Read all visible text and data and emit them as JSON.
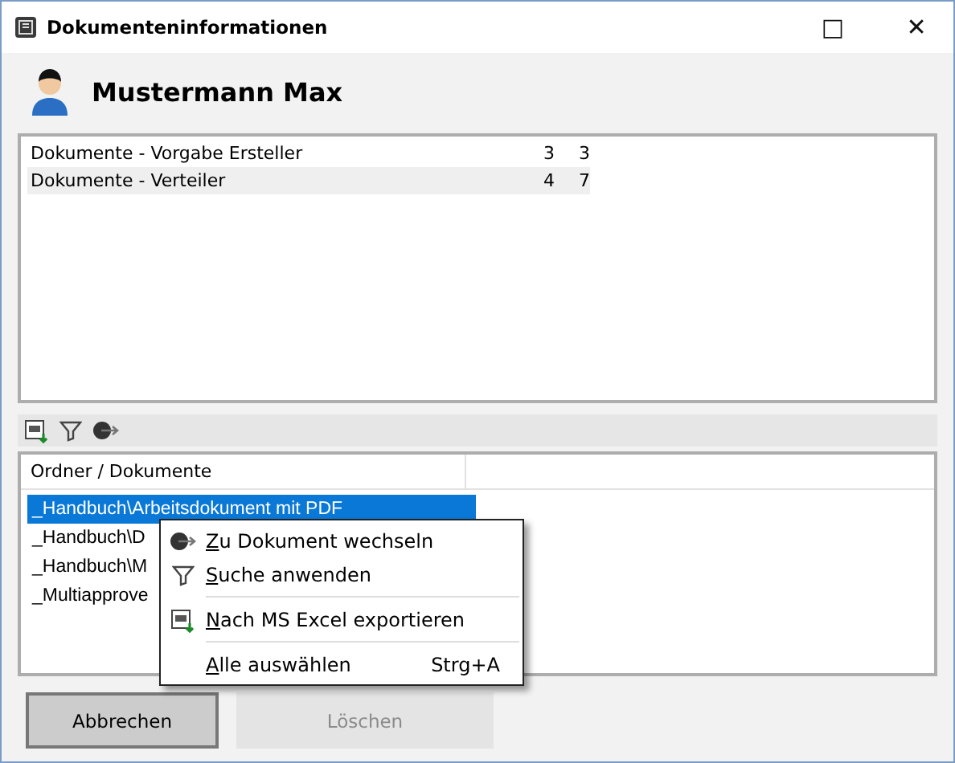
{
  "window": {
    "title": "Dokumenteninformationen",
    "controls": [
      "□",
      "✕"
    ]
  },
  "user": {
    "name": "Mustermann Max"
  },
  "summary": {
    "rows": [
      {
        "label": "Dokumente - Vorgabe Ersteller",
        "column_2": "3",
        "column_3": "3",
        "selected": false
      },
      {
        "label": "Dokumente - Verteiler",
        "column_2": "4",
        "column_3": "7",
        "selected": true
      }
    ]
  },
  "toolbar": [
    {
      "kind": "excel"
    },
    {
      "kind": "filter"
    },
    {
      "kind": "goto"
    }
  ],
  "documents": {
    "columns": [
      "Ordner / Dokumente"
    ],
    "rows": [
      {
        "text": "_Handbuch\\Arbeitsdokument mit PDF",
        "selected": true
      },
      {
        "text": "_Handbuch\\D",
        "selected": false
      },
      {
        "text": "_Handbuch\\M",
        "selected": false
      },
      {
        "text": "_Multiapprove",
        "selected": false
      }
    ]
  },
  "context_menu": [
    {
      "kind": "goto",
      "label": "Zu Dokument wechseln"
    },
    {
      "kind": "filter",
      "label": "Suche anwenden"
    },
    {
      "kind": "separator"
    },
    {
      "kind": "excel",
      "label": "Nach MS Excel exportieren"
    },
    {
      "kind": "separator"
    },
    {
      "kind": "plain",
      "label": "Alle auswählen",
      "shortcut": "Strg+A"
    }
  ],
  "buttons": [
    {
      "label": "Abbrechen",
      "disabled": false
    },
    {
      "label": "Löschen",
      "disabled": true
    }
  ]
}
